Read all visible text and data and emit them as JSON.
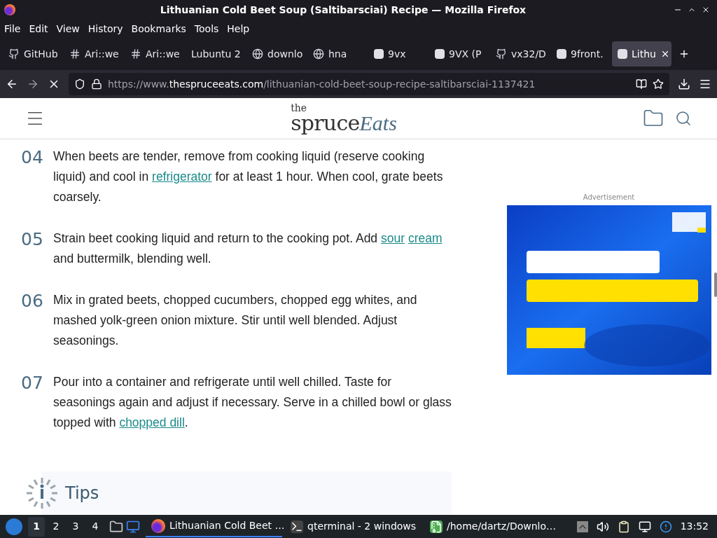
{
  "window": {
    "title": "Lithuanian Cold Beet Soup (Saltibarsciai) Recipe — Mozilla Firefox"
  },
  "menu": [
    "File",
    "Edit",
    "View",
    "History",
    "Bookmarks",
    "Tools",
    "Help"
  ],
  "tabs": [
    {
      "label": "GitHub",
      "selected": false
    },
    {
      "label": "Ari::we",
      "selected": false
    },
    {
      "label": "Ari::we",
      "selected": false
    },
    {
      "label": "Lubuntu 2",
      "selected": false
    },
    {
      "label": "downlo",
      "selected": false
    },
    {
      "label": "hna",
      "selected": false
    },
    {
      "label": "9vx",
      "selected": false
    },
    {
      "label": "9VX (P",
      "selected": false
    },
    {
      "label": "vx32/D",
      "selected": false
    },
    {
      "label": "9front.",
      "selected": false
    },
    {
      "label": "Lithu",
      "selected": true
    }
  ],
  "url": {
    "prefix": "https://www.",
    "domain": "thespruceeats.com",
    "path": "/lithuanian-cold-beet-soup-recipe-saltibarsciai-1137421"
  },
  "site": {
    "logo_small": "the",
    "logo_main": "spruce",
    "logo_script": "Eats"
  },
  "steps": [
    {
      "number": "04",
      "parts": [
        {
          "kind": "text",
          "text": "When beets are tender, remove from cooking liquid (reserve cooking liquid) and cool in "
        },
        {
          "kind": "link",
          "text": "refrigerator"
        },
        {
          "kind": "text",
          "text": " for at least 1 hour. When cool, grate beets coarsely."
        }
      ]
    },
    {
      "number": "05",
      "parts": [
        {
          "kind": "text",
          "text": "Strain beet cooking liquid and return to the cooking pot. Add "
        },
        {
          "kind": "link",
          "text": "sour"
        },
        {
          "kind": "link",
          "text": "cream"
        },
        {
          "kind": "text",
          "text": " and buttermilk, blending well."
        }
      ]
    },
    {
      "number": "06",
      "parts": [
        {
          "kind": "text",
          "text": "Mix in grated beets, chopped cucumbers, chopped egg whites, and mashed yolk-green onion mixture. Stir until well blended. Adjust seasonings."
        }
      ]
    },
    {
      "number": "07",
      "parts": [
        {
          "kind": "text",
          "text": "Pour into a container and refrigerate until well chilled. Taste for seasonings again and adjust if necessary. Serve in a chilled bowl or glass topped with "
        },
        {
          "kind": "link",
          "text": "chopped dill"
        },
        {
          "kind": "text",
          "text": "."
        }
      ]
    }
  ],
  "tips": {
    "title": "Tips"
  },
  "ad": {
    "label": "Advertisement",
    "kind": "picture"
  },
  "taskbar": {
    "workspaces": [
      {
        "label": "1",
        "selected": true
      },
      {
        "label": "2",
        "selected": false
      },
      {
        "label": "3",
        "selected": false
      },
      {
        "label": "4",
        "selected": false
      }
    ],
    "tasks": [
      {
        "kind": "browser",
        "label": "Lithuanian Cold Beet …",
        "selected": true
      },
      {
        "kind": "terminal",
        "label": "qterminal - 2 windows",
        "selected": false
      },
      {
        "kind": "archive",
        "label": "/home/dartz/Downlo…",
        "selected": false
      }
    ],
    "clock": "13:52"
  }
}
